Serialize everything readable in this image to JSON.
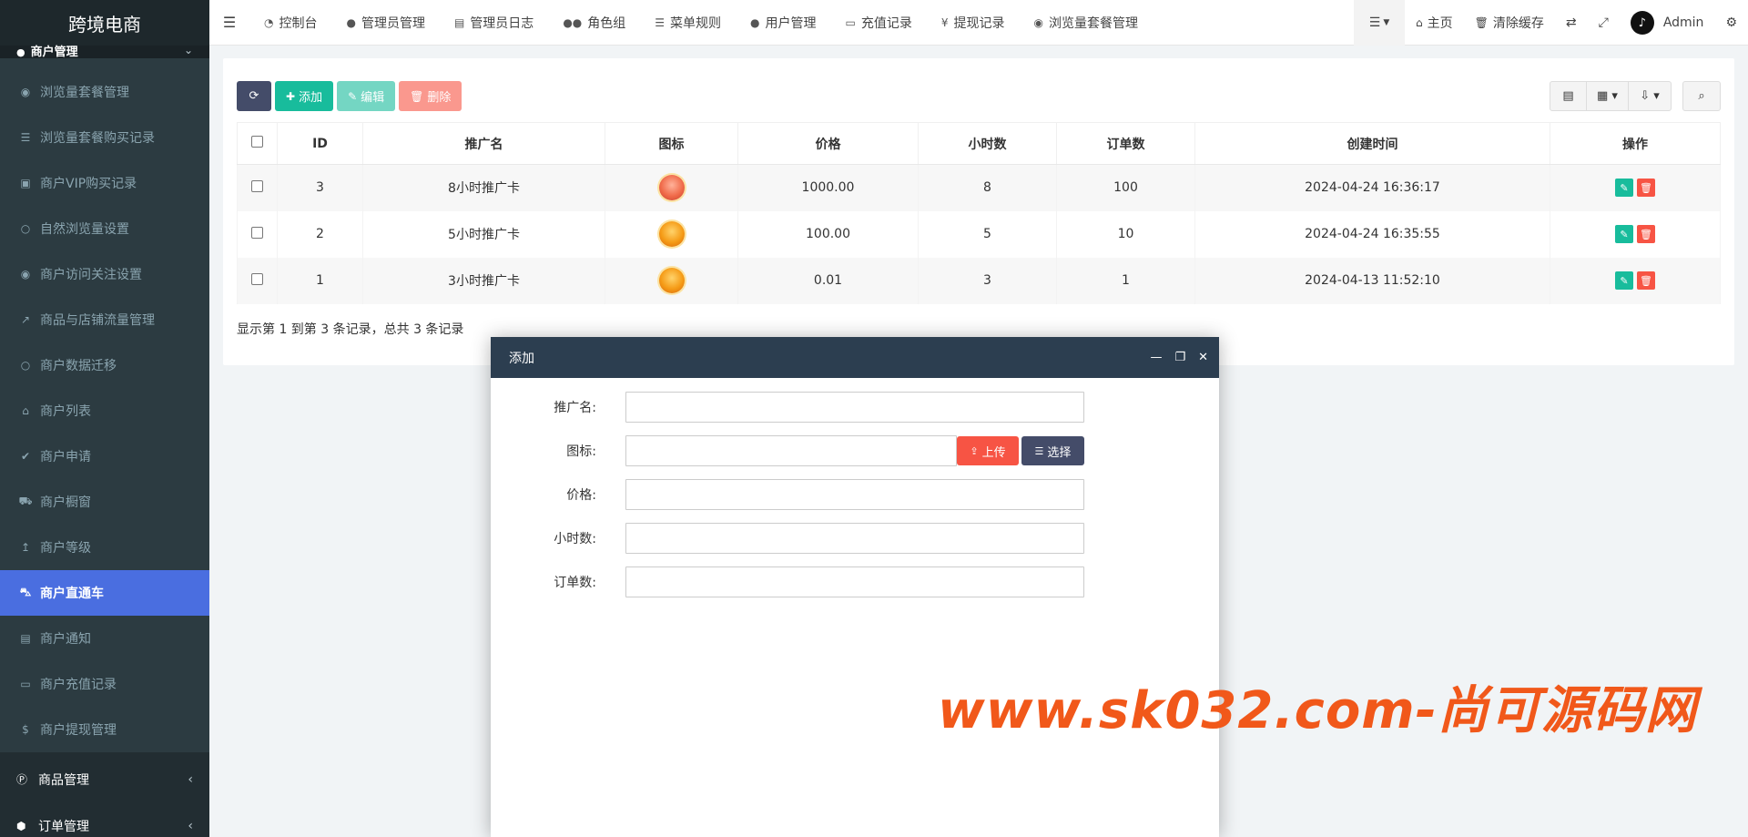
{
  "app": {
    "logo_text": "跨境电商"
  },
  "sidebar": {
    "top_parent": {
      "label": "商户管理"
    },
    "items": [
      {
        "icon": "eye-icon",
        "label": "浏览量套餐管理"
      },
      {
        "icon": "list-icon",
        "label": "浏览量套餐购买记录"
      },
      {
        "icon": "shopping-bag-icon",
        "label": "商户VIP购买记录"
      },
      {
        "icon": "circle-icon",
        "label": "自然浏览量设置"
      },
      {
        "icon": "eye-icon",
        "label": "商户访问关注设置"
      },
      {
        "icon": "line-chart-icon",
        "label": "商品与店铺流量管理"
      },
      {
        "icon": "circle-icon",
        "label": "商户数据迁移"
      },
      {
        "icon": "home-icon",
        "label": "商户列表"
      },
      {
        "icon": "check-circle-icon",
        "label": "商户申请"
      },
      {
        "icon": "cart-icon",
        "label": "商户橱窗"
      },
      {
        "icon": "level-up-icon",
        "label": "商户等级"
      },
      {
        "icon": "car-icon",
        "label": "商户直通车",
        "active": true
      },
      {
        "icon": "newspaper-icon",
        "label": "商户通知"
      },
      {
        "icon": "money-icon",
        "label": "商户充值记录"
      },
      {
        "icon": "dollar-icon",
        "label": "商户提现管理"
      }
    ],
    "bottom": [
      {
        "icon": "product-icon",
        "label": "商品管理"
      },
      {
        "icon": "cube-icon",
        "label": "订单管理"
      }
    ]
  },
  "topbar": {
    "tabs": [
      {
        "icon": "dashboard-icon",
        "label": "控制台"
      },
      {
        "icon": "user-icon",
        "label": "管理员管理"
      },
      {
        "icon": "list-alt-icon",
        "label": "管理员日志"
      },
      {
        "icon": "group-icon",
        "label": "角色组"
      },
      {
        "icon": "bars-icon",
        "label": "菜单规则"
      },
      {
        "icon": "user-icon",
        "label": "用户管理"
      },
      {
        "icon": "money-icon",
        "label": "充值记录"
      },
      {
        "icon": "yen-icon",
        "label": "提现记录"
      },
      {
        "icon": "eye-icon",
        "label": "浏览量套餐管理"
      }
    ],
    "right": {
      "home": "主页",
      "clear_cache": "清除缓存",
      "user_name": "Admin"
    }
  },
  "toolbar": {
    "add": "添加",
    "edit": "编辑",
    "delete": "删除"
  },
  "table": {
    "columns": [
      "ID",
      "推广名",
      "图标",
      "价格",
      "小时数",
      "订单数",
      "创建时间",
      "操作"
    ],
    "rows": [
      {
        "id": "3",
        "name": "8小时推广卡",
        "icon": "medal-red",
        "price": "1000.00",
        "hours": "8",
        "orders": "100",
        "created": "2024-04-24 16:36:17"
      },
      {
        "id": "2",
        "name": "5小时推广卡",
        "icon": "medal-gold",
        "price": "100.00",
        "hours": "5",
        "orders": "10",
        "created": "2024-04-24 16:35:55"
      },
      {
        "id": "1",
        "name": "3小时推广卡",
        "icon": "medal-gold",
        "price": "0.01",
        "hours": "3",
        "orders": "1",
        "created": "2024-04-13 11:52:10"
      }
    ],
    "pagination_info": "显示第 1 到第 3 条记录，总共 3 条记录"
  },
  "modal": {
    "title": "添加",
    "fields": [
      {
        "label": "推广名:",
        "value": ""
      },
      {
        "label": "图标:",
        "value": ""
      },
      {
        "label": "价格:",
        "value": ""
      },
      {
        "label": "小时数:",
        "value": ""
      },
      {
        "label": "订单数:",
        "value": ""
      }
    ],
    "upload_label": "上传",
    "select_label": "选择"
  },
  "watermark": "www.sk032.com-尚可源码网"
}
